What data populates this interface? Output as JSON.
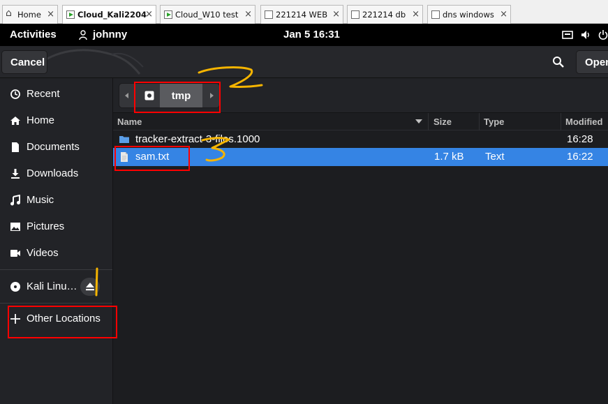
{
  "vm_tabs": [
    {
      "label": "Home",
      "icon": "home-icon",
      "active": false
    },
    {
      "label": "Cloud_Kali2204",
      "icon": "vm-running-icon",
      "active": true
    },
    {
      "label": "Cloud_W10 test",
      "icon": "vm-running-icon",
      "active": false
    },
    {
      "label": "221214 WEB",
      "icon": "vm-icon",
      "active": false
    },
    {
      "label": "221214 db",
      "icon": "vm-icon",
      "active": false
    },
    {
      "label": "dns windows",
      "icon": "vm-icon",
      "active": false
    }
  ],
  "topbar": {
    "activities": "Activities",
    "user": "johnny",
    "clock": "Jan 5  16:31"
  },
  "headerbar": {
    "cancel_label": "Cancel",
    "open_label": "Open"
  },
  "sidebar": {
    "places": [
      {
        "label": "Recent",
        "icon": "clock-icon"
      },
      {
        "label": "Home",
        "icon": "home-icon"
      },
      {
        "label": "Documents",
        "icon": "document-icon"
      },
      {
        "label": "Downloads",
        "icon": "download-icon"
      },
      {
        "label": "Music",
        "icon": "music-icon"
      },
      {
        "label": "Pictures",
        "icon": "picture-icon"
      },
      {
        "label": "Videos",
        "icon": "video-icon"
      }
    ],
    "device": {
      "label": "Kali Linu…",
      "icon": "disc-icon"
    },
    "other_locations": {
      "label": "Other Locations",
      "icon": "plus-icon"
    }
  },
  "pathbar": {
    "current": "tmp"
  },
  "columns": {
    "name": "Name",
    "size": "Size",
    "type": "Type",
    "modified": "Modified"
  },
  "files": [
    {
      "name": "tracker-extract-3-files.1000",
      "size": "",
      "type": "",
      "modified": "16:28",
      "kind": "folder",
      "selected": false
    },
    {
      "name": "sam.txt",
      "size": "1.7 kB",
      "type": "Text",
      "modified": "16:22",
      "kind": "text-file",
      "selected": true
    }
  ],
  "annotations": {
    "color_box": "#ff0000",
    "color_handwriting": "#f5b400",
    "numbers_written": [
      "2",
      "3"
    ]
  },
  "colors": {
    "selection": "#3584e4",
    "topbar": "#000000",
    "folder": "#5a9ee8"
  }
}
